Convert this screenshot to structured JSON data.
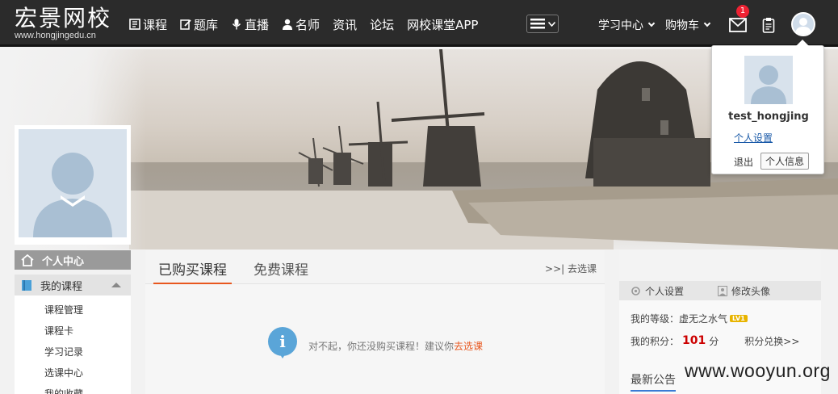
{
  "logo": {
    "main": "宏景网校",
    "sub": "www.hongjingedu.cn"
  },
  "nav": {
    "items": [
      {
        "label": "课程",
        "icon": "book-icon"
      },
      {
        "label": "题库",
        "icon": "edit-icon"
      },
      {
        "label": "直播",
        "icon": "microphone-icon"
      },
      {
        "label": "名师",
        "icon": "user-icon"
      },
      {
        "label": "资讯",
        "icon": ""
      },
      {
        "label": "论坛",
        "icon": ""
      },
      {
        "label": "网校课堂APP",
        "icon": ""
      }
    ],
    "study_center": "学习中心",
    "cart": "购物车",
    "mail_badge": "1"
  },
  "dropdown": {
    "username": "test_hongjing",
    "settings_link": "个人设置",
    "logout": "退出",
    "info_button": "个人信息"
  },
  "sidebar": {
    "header": "个人中心",
    "my_courses": "我的课程",
    "links": [
      "课程管理",
      "课程卡",
      "学习记录",
      "选课中心",
      "我的收藏"
    ]
  },
  "main": {
    "tab_active": "已购买课程",
    "tab_free": "免费课程",
    "goto_select": "去选课",
    "empty_message": "对不起，你还没购买课程！建议你",
    "empty_link": "去选课"
  },
  "right_panel": {
    "personal_settings": "个人设置",
    "change_avatar": "修改头像",
    "level_label": "我的等级：",
    "level_name": "虚无之水气",
    "level_badge": "LV1",
    "points_label": "我的积分：",
    "points_value": "101",
    "points_unit": "分",
    "points_exchange": "积分兑换>>",
    "notice_title": "最新公告"
  },
  "watermark": "www.wooyun.org",
  "colors": {
    "accent": "#e8571e",
    "topbar": "#2b2b2b",
    "link": "#1a5aa8",
    "points": "#cc0000"
  }
}
